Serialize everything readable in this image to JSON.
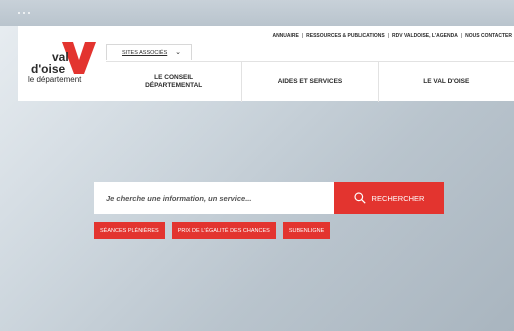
{
  "logo": {
    "line1": "val",
    "line2": "d'oise",
    "line3": "le département"
  },
  "sites_tab": {
    "label": "SITES ASSOCIÉS"
  },
  "utility_nav": [
    "ANNUAIRE",
    "RESSOURCES & PUBLICATIONS",
    "RDV VALDOISE, L'AGENDA",
    "NOUS CONTACTER"
  ],
  "utility_separator": "|",
  "main_nav": [
    "LE CONSEIL DÉPARTEMENTAL",
    "AIDES ET SERVICES",
    "LE VAL D'OISE"
  ],
  "search": {
    "placeholder": "Je cherche une information, un service...",
    "button_label": "RECHERCHER"
  },
  "quick_tags": [
    "SÉANCES PLÉNIÈRES",
    "PRIX DE L'ÉGALITÉ DES CHANCES",
    "SUBENLIGNE"
  ],
  "colors": {
    "accent": "#e3342f",
    "text": "#2b2b2b",
    "header_bg": "#ffffff"
  }
}
